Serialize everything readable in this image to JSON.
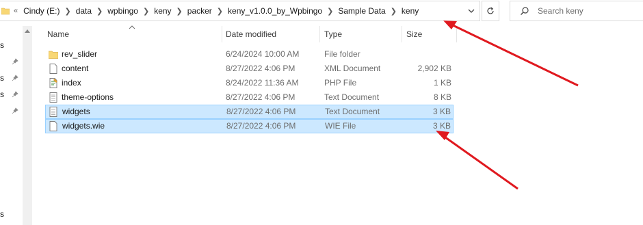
{
  "address_bar": {
    "overflow": "«",
    "crumbs": [
      "Cindy (E:)",
      "data",
      "wpbingo",
      "keny",
      "packer",
      "keny_v1.0.0_by_Wpbingo",
      "Sample Data",
      "keny"
    ]
  },
  "search": {
    "placeholder": "Search keny"
  },
  "nav_pane": {
    "labels": [
      "s",
      "s",
      "s",
      "s"
    ]
  },
  "columns": {
    "name": "Name",
    "date": "Date modified",
    "type": "Type",
    "size": "Size"
  },
  "files": [
    {
      "name": "rev_slider",
      "date": "6/24/2024 10:00 AM",
      "type": "File folder",
      "size": "",
      "icon": "folder-icon",
      "selected": false
    },
    {
      "name": "content",
      "date": "8/27/2022 4:06 PM",
      "type": "XML Document",
      "size": "2,902 KB",
      "icon": "document-icon",
      "selected": false
    },
    {
      "name": "index",
      "date": "8/24/2022 11:36 AM",
      "type": "PHP File",
      "size": "1 KB",
      "icon": "php-file-icon",
      "selected": false
    },
    {
      "name": "theme-options",
      "date": "8/27/2022 4:06 PM",
      "type": "Text Document",
      "size": "8 KB",
      "icon": "text-file-icon",
      "selected": false
    },
    {
      "name": "widgets",
      "date": "8/27/2022 4:06 PM",
      "type": "Text Document",
      "size": "3 KB",
      "icon": "text-file-icon",
      "selected": true
    },
    {
      "name": "widgets.wie",
      "date": "8/27/2022 4:06 PM",
      "type": "WIE File",
      "size": "3 KB",
      "icon": "document-icon",
      "selected": true
    }
  ],
  "colors": {
    "selection": "#cce8ff",
    "selection_border": "#99d1ff",
    "annotation_arrow": "#e0191f"
  }
}
